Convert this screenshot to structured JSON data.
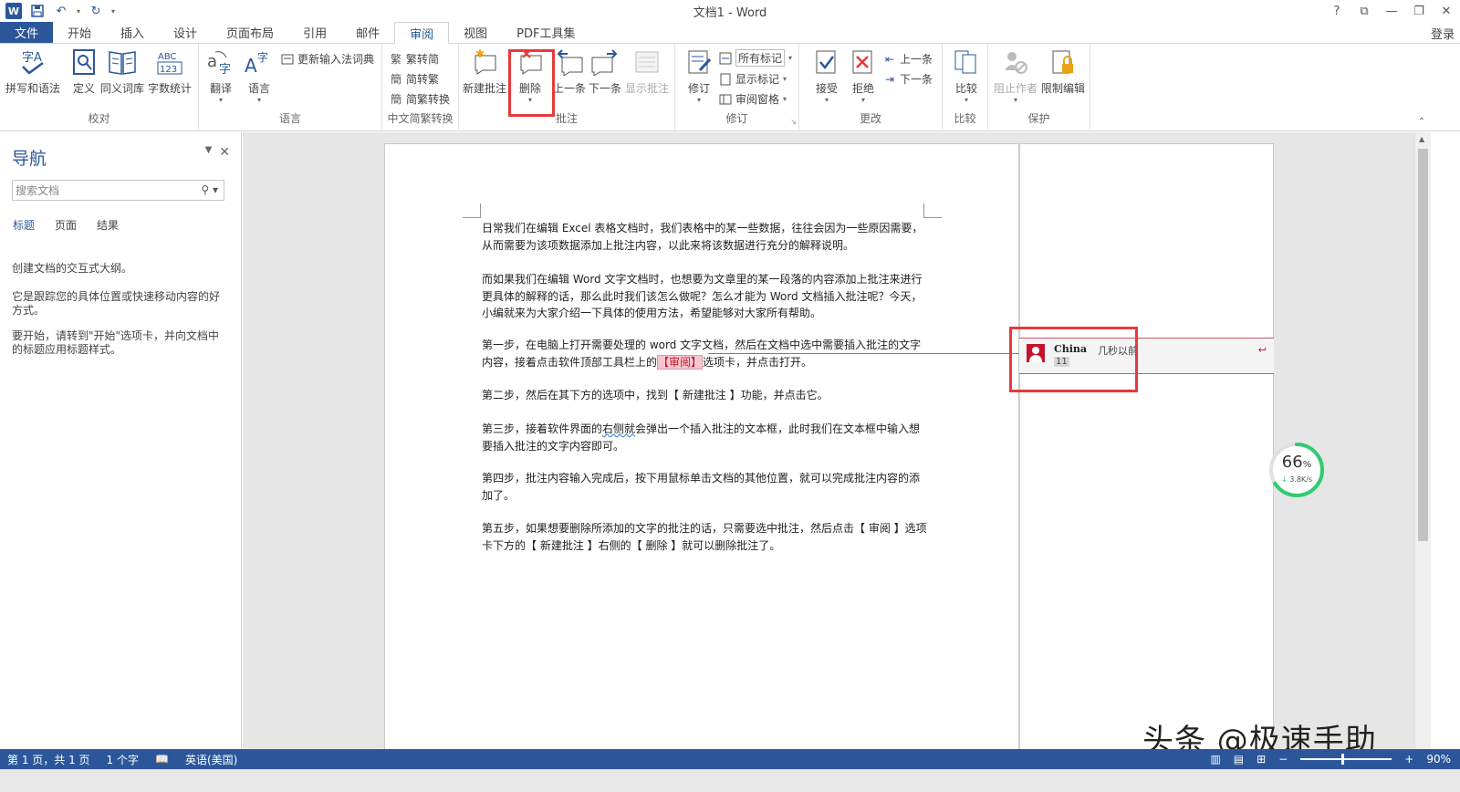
{
  "window": {
    "title": "文档1 - Word",
    "help": "?",
    "ribbon_display": "⧉",
    "minimize": "—",
    "restore": "❐",
    "close": "✕",
    "login": "登录"
  },
  "tabs": [
    "文件",
    "开始",
    "插入",
    "设计",
    "页面布局",
    "引用",
    "邮件",
    "审阅",
    "视图",
    "PDF工具集"
  ],
  "active_tab": "审阅",
  "ribbon": {
    "proofing": {
      "label": "校对",
      "spelling": "拼写和语法",
      "define": "定义",
      "thesaurus": "同义词库",
      "word_count": "字数统计"
    },
    "language": {
      "label": "语言",
      "translate": "翻译",
      "language": "语言",
      "update_ime": "更新输入法词典"
    },
    "chinese": {
      "label": "中文简繁转换",
      "to_simplified": "繁转简",
      "to_traditional": "简转繁",
      "convert": "简繁转换"
    },
    "comments": {
      "label": "批注",
      "new": "新建批注",
      "delete": "删除",
      "previous": "上一条",
      "next": "下一条",
      "show": "显示批注"
    },
    "tracking": {
      "label": "修订",
      "track": "修订",
      "all_markup": "所有标记",
      "show_markup": "显示标记",
      "review_pane": "审阅窗格"
    },
    "changes": {
      "label": "更改",
      "accept": "接受",
      "reject": "拒绝",
      "previous": "上一条",
      "next": "下一条"
    },
    "compare": {
      "label": "比较",
      "compare": "比较"
    },
    "protect": {
      "label": "保护",
      "block_authors": "阻止作者",
      "restrict": "限制编辑"
    }
  },
  "nav": {
    "title": "导航",
    "search_placeholder": "搜索文档",
    "tabs": [
      "标题",
      "页面",
      "结果"
    ],
    "text1": "创建文档的交互式大纲。",
    "text2": "它是跟踪您的具体位置或快速移动内容的好方式。",
    "text3": "要开始，请转到\"开始\"选项卡，并向文档中的标题应用标题样式。"
  },
  "document": {
    "p1": "日常我们在编辑 Excel 表格文档时，我们表格中的某一些数据，往往会因为一些原因需要，从而需要为该项数据添加上批注内容，以此来将该数据进行充分的解释说明。",
    "p2": "而如果我们在编辑 Word 文字文档时，也想要为文章里的某一段落的内容添加上批注来进行更具体的解释的话，那么此时我们该怎么做呢？怎么才能为 Word 文档插入批注呢？今天，小编就来为大家介绍一下具体的使用方法，希望能够对大家所有帮助。",
    "p3a": "第一步，在电脑上打开需要处理的 word 文字文档，然后在文档中选中需要插入批注的文字内容，接着点击软件顶部工具栏上的",
    "p3hl": "【审阅】",
    "p3b": "选项卡，并点击打开。",
    "p4": "第二步，然后在其下方的选项中，找到【 新建批注 】功能，并点击它。",
    "p5a": "第三步，接着软件界面的",
    "p5w": "右侧就",
    "p5b": "会弹出一个插入批注的文本框，此时我们在文本框中输入想要插入批注的文字内容即可。",
    "p6": "第四步，批注内容输入完成后，按下用鼠标单击文档的其他位置，就可以完成批注内容的添加了。",
    "p7": "第五步，如果想要删除所添加的文字的批注的话，只需要选中批注，然后点击【 审阅 】选项卡下方的【 新建批注 】右侧的【 删除 】就可以删除批注了。"
  },
  "comment": {
    "author": "China",
    "time": "几秒以前",
    "text": "11"
  },
  "progress": {
    "percent_value": 66,
    "percent": "66",
    "unit": "%",
    "speed": "3.8K/s"
  },
  "status": {
    "page": "第 1 页，共 1 页",
    "words": "1 个字",
    "language": "英语(美国)",
    "zoom": "90%"
  },
  "watermark": "头条 @极速手助",
  "colors": {
    "accent": "#2b579a",
    "highlight_box": "#e8393a",
    "comment_line": "#d2556a",
    "progress_green": "#2ecc71"
  }
}
